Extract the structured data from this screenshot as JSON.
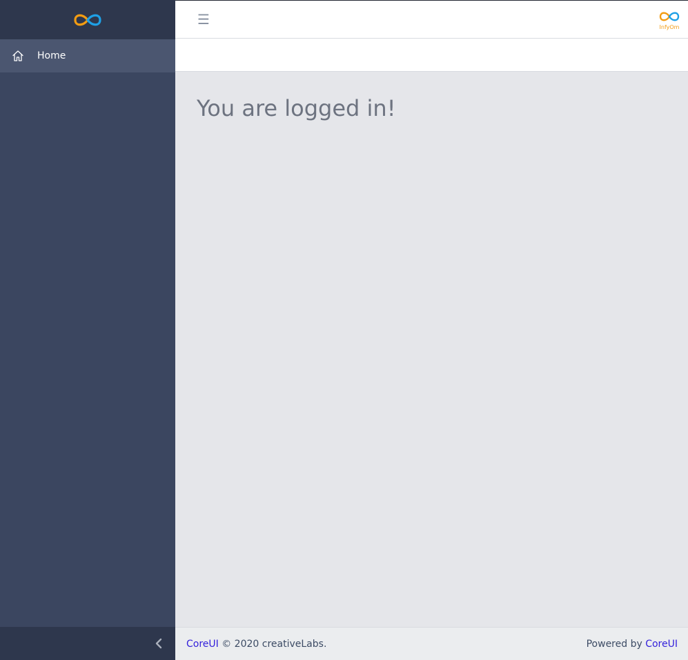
{
  "sidebar": {
    "items": [
      {
        "label": "Home",
        "icon": "home-icon"
      }
    ],
    "minimizer_icon": "chevron-left-icon"
  },
  "header": {
    "toggler_glyph": "☰",
    "logo_text": "InfyOm"
  },
  "main": {
    "message": "You are logged in!"
  },
  "footer": {
    "left_link": "CoreUI",
    "left_text": "© 2020 creativeLabs.",
    "right_prefix": "Powered by",
    "right_link": "CoreUI"
  },
  "colors": {
    "sidebar_bg": "#3b4660",
    "sidebar_brand_bg": "#2e374d",
    "active_item_bg": "#4b5670",
    "content_bg": "#e5e6ea",
    "link": "#321fdb",
    "logo_orange": "#f39c12",
    "logo_blue": "#1ea0e6"
  }
}
